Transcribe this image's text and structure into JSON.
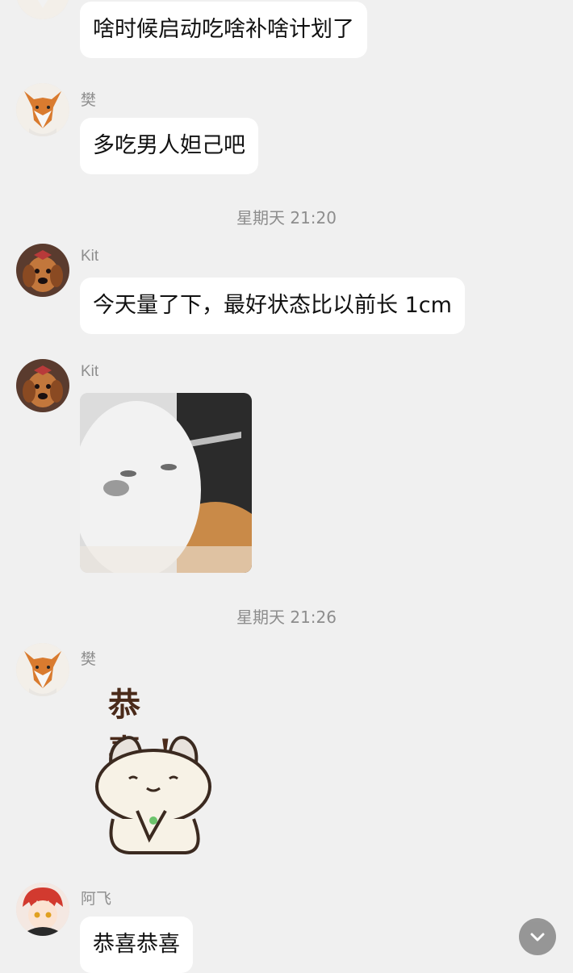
{
  "messages": [
    {
      "text": "啥时候启动吃啥补啥计划了"
    },
    {
      "sender": "樊",
      "text": "多吃男人妲己吧"
    },
    {
      "timestamp": "星期天 21:20"
    },
    {
      "sender": "Kit",
      "text": "今天量了下，最好状态比以前长 1cm"
    },
    {
      "sender": "Kit",
      "image": "rabbit-photo"
    },
    {
      "timestamp": "星期天 21:26"
    },
    {
      "sender": "樊",
      "sticker_text": "恭 喜!"
    },
    {
      "sender": "阿飞",
      "text": "恭喜恭喜"
    }
  ],
  "avatars": {
    "fox": "fox-avatar",
    "dog": "dog-avatar",
    "anime": "anime-avatar"
  },
  "scroll_button": {
    "icon": "chevron-down-icon"
  }
}
